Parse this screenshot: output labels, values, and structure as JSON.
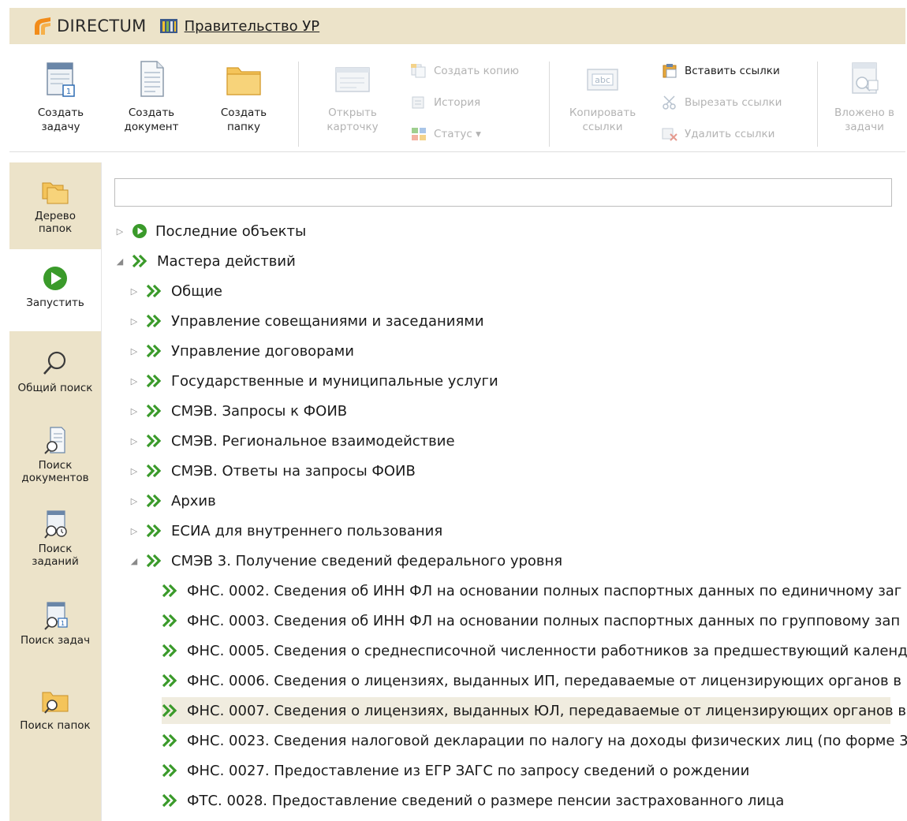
{
  "header": {
    "brand": "DIRECTUM",
    "organization": "Правительство УР"
  },
  "ribbon": {
    "create_task": "Создать задачу",
    "create_document": "Создать документ",
    "create_folder": "Создать папку",
    "open_card": "Открыть карточку",
    "create_copy": "Создать копию",
    "history": "История",
    "status": "Статус ▾",
    "copy_links": "Копировать ссылки",
    "paste_links": "Вставить ссылки",
    "cut_links": "Вырезать ссылки",
    "delete_links": "Удалить ссылки",
    "attached_in_tasks": "Вложено в задачи"
  },
  "nav": {
    "folder_tree": "Дерево папок",
    "run": "Запустить",
    "general_search": "Общий поиск",
    "doc_search": "Поиск документов",
    "assignment_search": "Поиск заданий",
    "task_search": "Поиск задач",
    "folder_search": "Поиск папок"
  },
  "search": {
    "value": "",
    "placeholder": ""
  },
  "tree": [
    {
      "label": "Последние объекты",
      "level": 0,
      "expander": "collapsed",
      "icon": "play-icon"
    },
    {
      "label": "Мастера действий",
      "level": 0,
      "expander": "expanded",
      "icon": "double-chevron-icon"
    },
    {
      "label": "Общие",
      "level": 1,
      "expander": "collapsed",
      "icon": "double-chevron-icon"
    },
    {
      "label": "Управление совещаниями и заседаниями",
      "level": 1,
      "expander": "collapsed",
      "icon": "double-chevron-icon"
    },
    {
      "label": "Управление договорами",
      "level": 1,
      "expander": "collapsed",
      "icon": "double-chevron-icon"
    },
    {
      "label": "Государственные и муниципальные услуги",
      "level": 1,
      "expander": "collapsed",
      "icon": "double-chevron-icon"
    },
    {
      "label": "СМЭВ. Запросы к ФОИВ",
      "level": 1,
      "expander": "collapsed",
      "icon": "double-chevron-icon"
    },
    {
      "label": "СМЭВ. Региональное взаимодействие",
      "level": 1,
      "expander": "collapsed",
      "icon": "double-chevron-icon"
    },
    {
      "label": "СМЭВ. Ответы на запросы ФОИВ",
      "level": 1,
      "expander": "collapsed",
      "icon": "double-chevron-icon"
    },
    {
      "label": "Архив",
      "level": 1,
      "expander": "collapsed",
      "icon": "double-chevron-icon"
    },
    {
      "label": "ЕСИА для внутреннего пользования",
      "level": 1,
      "expander": "collapsed",
      "icon": "double-chevron-icon"
    },
    {
      "label": "СМЭВ 3. Получение сведений федерального уровня",
      "level": 1,
      "expander": "expanded",
      "icon": "double-chevron-icon"
    },
    {
      "label": "ФНС. 0002. Сведения об ИНН ФЛ на основании полных паспортных данных по единичному заг",
      "level": 2,
      "expander": "none",
      "icon": "double-chevron-icon"
    },
    {
      "label": "ФНС. 0003. Сведения об ИНН ФЛ на основании полных паспортных данных по групповому зап",
      "level": 2,
      "expander": "none",
      "icon": "double-chevron-icon"
    },
    {
      "label": "ФНС. 0005. Сведения о среднесписочной численности работников за предшествующий календ",
      "level": 2,
      "expander": "none",
      "icon": "double-chevron-icon"
    },
    {
      "label": "ФНС. 0006. Сведения о лицензиях, выданных ИП, передаваемые от лицензирующих органов в",
      "level": 2,
      "expander": "none",
      "icon": "double-chevron-icon"
    },
    {
      "label": "ФНС. 0007. Сведения о лицензиях, выданных ЮЛ, передаваемые от лицензирующих органов в",
      "level": 2,
      "expander": "none",
      "icon": "double-chevron-icon",
      "selected": true
    },
    {
      "label": "ФНС. 0023. Сведения налоговой декларации по налогу на доходы физических лиц (по форме 3",
      "level": 2,
      "expander": "none",
      "icon": "double-chevron-icon"
    },
    {
      "label": "ФНС. 0027. Предоставление из ЕГР ЗАГС по запросу сведений о рождении",
      "level": 2,
      "expander": "none",
      "icon": "double-chevron-icon"
    },
    {
      "label": "ФТС. 0028. Предоставление сведений о размере пенсии застрахованного лица",
      "level": 2,
      "expander": "none",
      "icon": "double-chevron-icon"
    }
  ],
  "colors": {
    "accent_green": "#3a9a2a",
    "header_bg": "#ece3c9",
    "selection_bg": "#f0ecdf"
  }
}
